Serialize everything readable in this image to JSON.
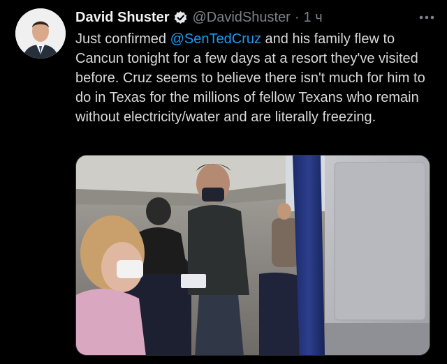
{
  "tweet": {
    "author_name": "David Shuster",
    "handle": "@DavidShuster",
    "separator": "·",
    "time": "1 ч",
    "text_before": "Just confirmed ",
    "mention": "@SenTedCruz",
    "text_after": " and his family flew to Cancun tonight for a few days at a resort they've visited before. Cruz seems to believe there isn't much for him to do in Texas for the millions of fellow Texans who remain without electricity/water and are literally freezing."
  },
  "icons": {
    "verified": "verified-badge-icon",
    "more": "more-options-icon"
  },
  "colors": {
    "background": "#000000",
    "text": "#d9d9d9",
    "secondary": "#7b8288",
    "mention": "#1d9bf0"
  }
}
